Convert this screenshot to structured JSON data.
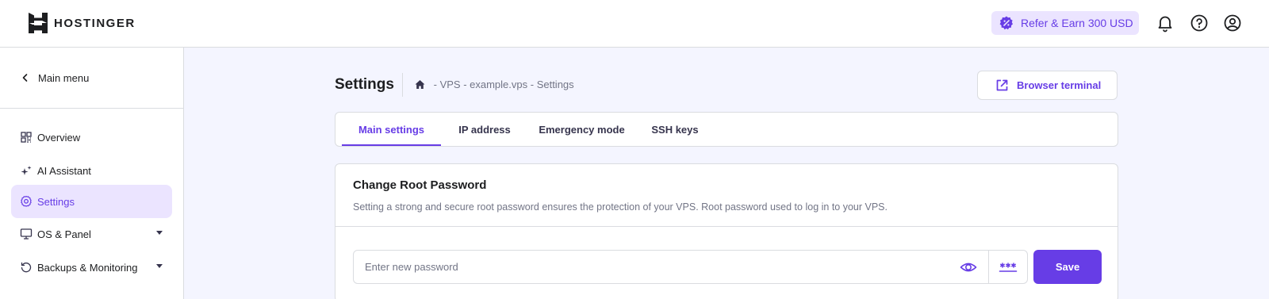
{
  "brand": {
    "name": "HOSTINGER"
  },
  "header": {
    "refer_label": "Refer & Earn 300 USD",
    "icons": [
      "bell-icon",
      "help-icon",
      "account-icon"
    ]
  },
  "sidebar": {
    "back_label": "Main menu",
    "items": [
      {
        "label": "Overview",
        "icon": "overview-icon"
      },
      {
        "label": "AI Assistant",
        "icon": "sparkle-icon"
      },
      {
        "label": "Settings",
        "icon": "gear-icon",
        "active": true
      },
      {
        "label": "OS & Panel",
        "icon": "monitor-icon",
        "expandable": true
      },
      {
        "label": "Backups & Monitoring",
        "icon": "history-icon",
        "expandable": true
      }
    ]
  },
  "page": {
    "title": "Settings",
    "breadcrumb": [
      "VPS",
      "example.vps",
      "Settings"
    ],
    "breadcrumb_separator": " - ",
    "terminal_button": "Browser terminal"
  },
  "tabs": [
    {
      "label": "Main settings",
      "active": true
    },
    {
      "label": "IP address"
    },
    {
      "label": "Emergency mode"
    },
    {
      "label": "SSH keys"
    }
  ],
  "card": {
    "title": "Change Root Password",
    "description": "Setting a strong and secure root password ensures the protection of your VPS. Root password used to log in to your VPS.",
    "password": {
      "value": "",
      "placeholder": "Enter new password"
    },
    "save_label": "Save"
  },
  "colors": {
    "accent": "#673de6",
    "accent_light": "#ebe4ff",
    "background": "#f4f5ff",
    "border": "#dadce0",
    "muted_text": "#727586"
  }
}
